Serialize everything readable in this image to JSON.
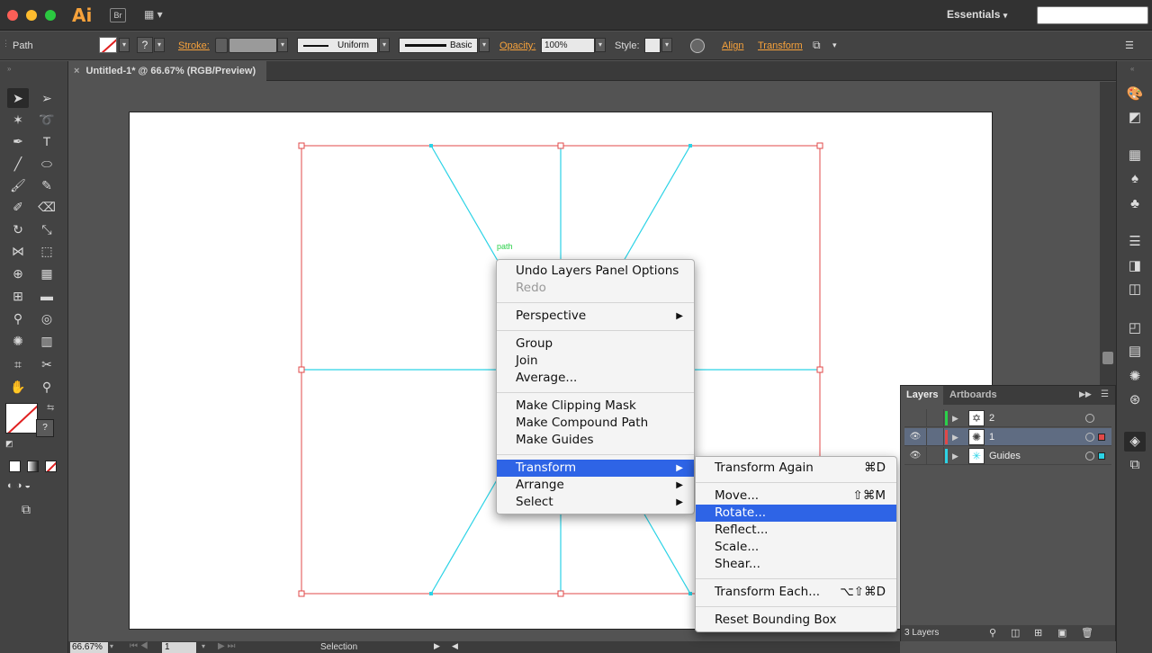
{
  "app": {
    "logo": "Ai",
    "bridge_label": "Br",
    "workspace": "Essentials"
  },
  "colors": {
    "accent_orange": "#f7a23b",
    "menu_highlight": "#2e64e6",
    "guide_cyan": "#2cd3e6",
    "bounding_red": "#e04848"
  },
  "control_bar": {
    "selection_type": "Path",
    "stroke_label": "Stroke:",
    "stroke_profile": "Uniform",
    "brush": "Basic",
    "opacity_label": "Opacity:",
    "opacity_value": "100%",
    "style_label": "Style:",
    "align_label": "Align",
    "transform_label": "Transform",
    "help_glyph": "?"
  },
  "document": {
    "tab_title": "Untitled-1* @ 66.67% (RGB/Preview)",
    "close_glyph": "×",
    "path_label": "path"
  },
  "status_bar": {
    "zoom": "66.67%",
    "artboard_number": "1",
    "status_text": "Selection"
  },
  "context_menu": {
    "items": [
      {
        "label": "Undo Layers Panel Options"
      },
      {
        "label": "Redo"
      },
      {
        "label": "Perspective"
      },
      {
        "label": "Group"
      },
      {
        "label": "Join"
      },
      {
        "label": "Average..."
      },
      {
        "label": "Make Clipping Mask"
      },
      {
        "label": "Make Compound Path"
      },
      {
        "label": "Make Guides"
      },
      {
        "label": "Transform"
      },
      {
        "label": "Arrange"
      },
      {
        "label": "Select"
      }
    ],
    "submenu_arrow": "▶"
  },
  "transform_submenu": {
    "items": [
      {
        "label": "Transform Again",
        "shortcut": "⌘D"
      },
      {
        "label": "Move...",
        "shortcut": "⇧⌘M"
      },
      {
        "label": "Rotate...",
        "shortcut": ""
      },
      {
        "label": "Reflect...",
        "shortcut": ""
      },
      {
        "label": "Scale...",
        "shortcut": ""
      },
      {
        "label": "Shear...",
        "shortcut": ""
      },
      {
        "label": "Transform Each...",
        "shortcut": "⌥⇧⌘D"
      },
      {
        "label": "Reset Bounding Box",
        "shortcut": ""
      }
    ]
  },
  "layers_panel": {
    "tabs": [
      "Layers",
      "Artboards"
    ],
    "layers": [
      {
        "name": "2",
        "color": "#2bd04a",
        "visible": false,
        "selected": false
      },
      {
        "name": "1",
        "color": "#e04848",
        "visible": true,
        "selected": true
      },
      {
        "name": "Guides",
        "color": "#2cd3e6",
        "visible": true,
        "selected": false
      }
    ],
    "count_label": "3 Layers"
  }
}
